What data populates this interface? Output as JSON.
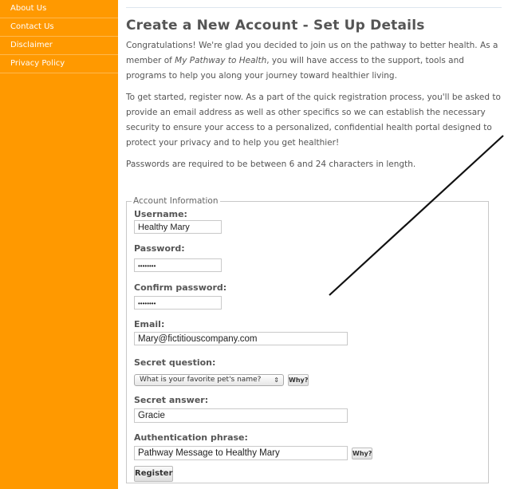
{
  "sidebar": {
    "items": [
      {
        "label": "About Us"
      },
      {
        "label": "Contact Us"
      },
      {
        "label": "Disclaimer"
      },
      {
        "label": "Privacy Policy"
      }
    ]
  },
  "main": {
    "title": "Create a New Account - Set Up Details",
    "intro": [
      "Congratulations! We're glad you decided to join us on the pathway to better health. As a member of ",
      "My Pathway to Health",
      ", you will have access to the support, tools and programs to help you along your journey toward healthier living."
    ],
    "para2": "To get started, register now. As a part of the quick registration process, you'll be asked to provide an email address as well as other specifics so we can establish the necessary security to ensure your access to a personalized, confidential health portal designed to protect your privacy and to help you get healthier!",
    "para3": "Passwords are required to be between 6 and 24 characters in length."
  },
  "form": {
    "legend": "Account Information",
    "username": {
      "label": "Username:",
      "value": "Healthy Mary"
    },
    "password": {
      "label": "Password:",
      "value": "••••••••"
    },
    "confirm": {
      "label": "Confirm password:",
      "value": "••••••••"
    },
    "email": {
      "label": "Email:",
      "value": "Mary@fictitiouscompany.com"
    },
    "question": {
      "label": "Secret question:",
      "value": "What is your favorite pet's name?"
    },
    "answer": {
      "label": "Secret answer:",
      "value": "Gracie"
    },
    "phrase": {
      "label": "Authentication phrase:",
      "value": "Pathway Message to Healthy Mary"
    },
    "why_label": "Why?",
    "register_label": "Register"
  },
  "colors": {
    "sidebar": "#ff9900",
    "text": "#555555"
  }
}
